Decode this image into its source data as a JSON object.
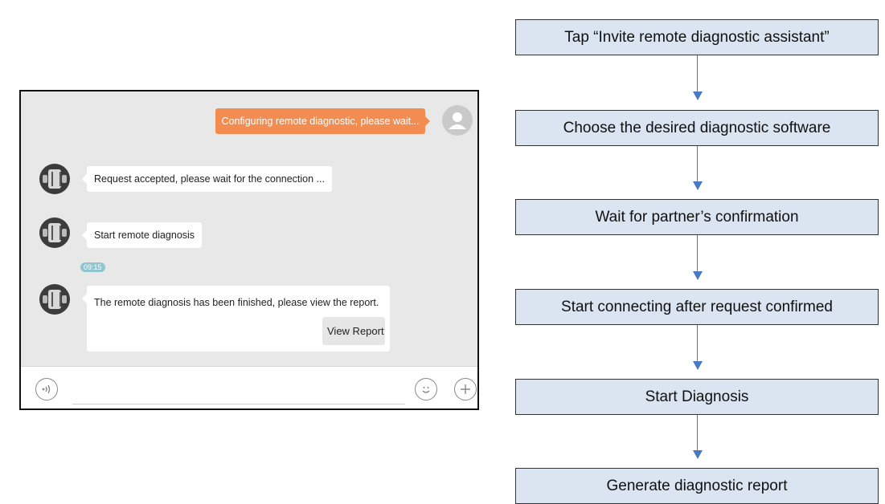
{
  "chat": {
    "outgoing_message": "Configuring remote diagnostic, please wait...",
    "messages": [
      "Request accepted, please wait for the connection ...",
      "Start remote diagnosis",
      "The remote diagnosis has been finished, please view the report."
    ],
    "timestamp": "09:15",
    "view_report_label": "View Report",
    "input_placeholder": "",
    "icons": [
      "user-avatar-icon",
      "agent-avatar-icon",
      "voice-icon",
      "emoji-icon",
      "add-icon"
    ]
  },
  "flowchart": {
    "steps": [
      "Tap “Invite remote diagnostic assistant”",
      "Choose the desired diagnostic software",
      "Wait for partner’s confirmation",
      "Start connecting after request confirmed",
      "Start Diagnosis",
      "Generate diagnostic report"
    ],
    "colors": {
      "box_fill": "#dbe4f1",
      "arrow": "#4a78c2",
      "outgoing_bubble": "#f28c50"
    }
  }
}
